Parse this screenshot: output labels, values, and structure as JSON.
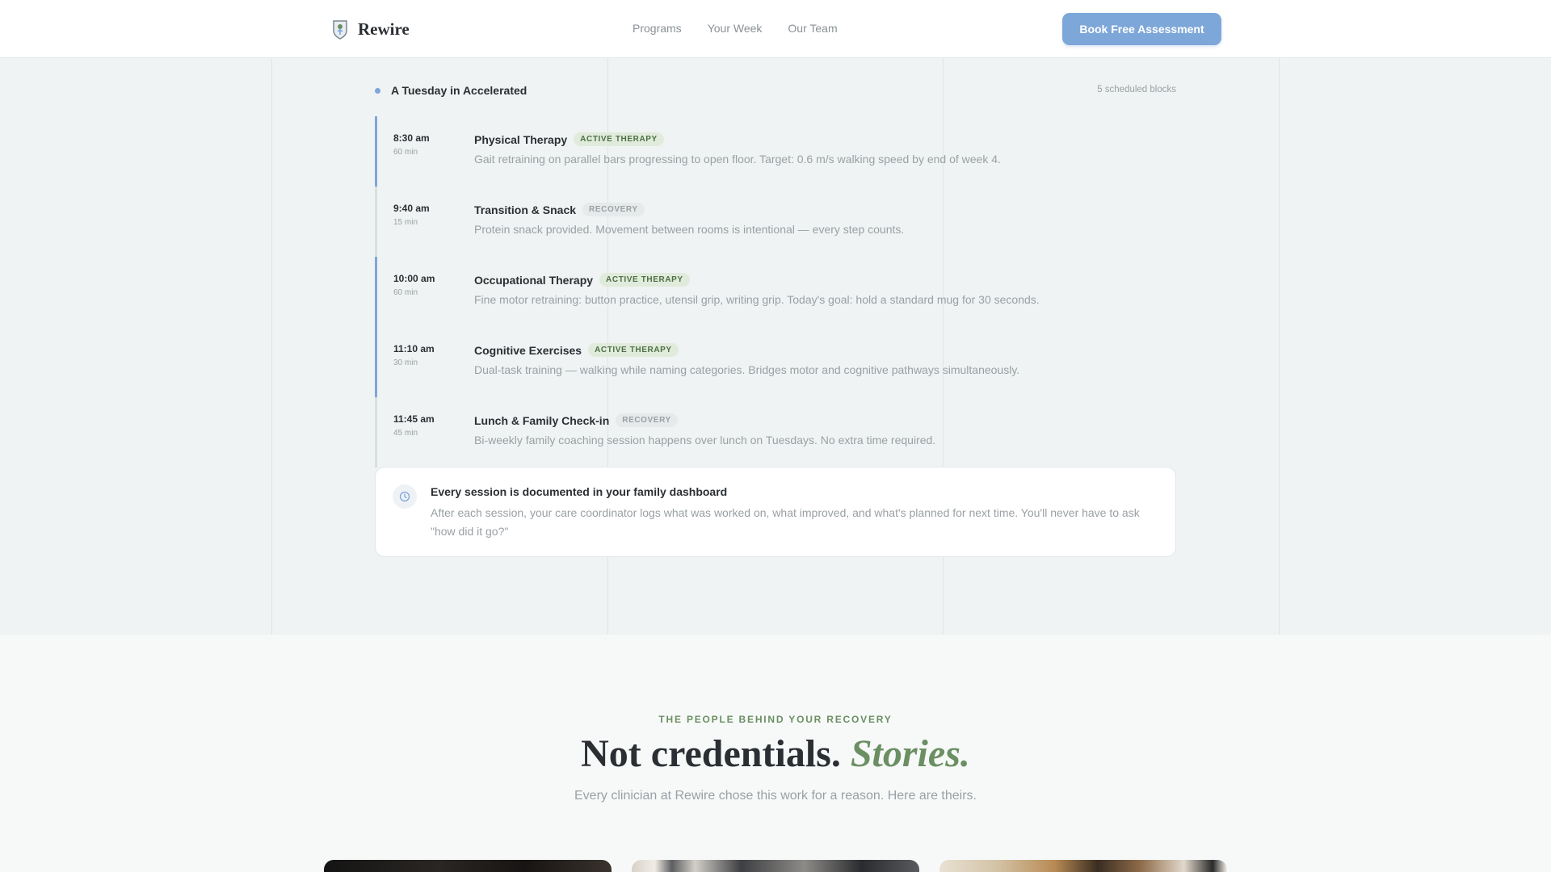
{
  "nav": {
    "brand_name": "Rewire",
    "links": [
      {
        "label": "Programs"
      },
      {
        "label": "Your Week"
      },
      {
        "label": "Our Team"
      }
    ],
    "cta_label": "Book Free Assessment"
  },
  "schedule": {
    "title": "A Tuesday in Accelerated",
    "count_label": "5 scheduled blocks",
    "blocks": [
      {
        "time": "8:30 am",
        "duration": "60 min",
        "title": "Physical Therapy",
        "tag": "ACTIVE THERAPY",
        "description": "Gait retraining on parallel bars progressing to open floor. Target: 0.6 m/s walking speed by end of week 4."
      },
      {
        "time": "9:40 am",
        "duration": "15 min",
        "title": "Transition & Snack",
        "tag": "RECOVERY",
        "description": "Protein snack provided. Movement between rooms is intentional — every step counts."
      },
      {
        "time": "10:00 am",
        "duration": "60 min",
        "title": "Occupational Therapy",
        "tag": "ACTIVE THERAPY",
        "description": "Fine motor retraining: button practice, utensil grip, writing grip. Today's goal: hold a standard mug for 30 seconds."
      },
      {
        "time": "11:10 am",
        "duration": "30 min",
        "title": "Cognitive Exercises",
        "tag": "ACTIVE THERAPY",
        "description": "Dual-task training — walking while naming categories. Bridges motor and cognitive pathways simultaneously."
      },
      {
        "time": "11:45 am",
        "duration": "45 min",
        "title": "Lunch & Family Check-in",
        "tag": "RECOVERY",
        "description": "Bi-weekly family coaching session happens over lunch on Tuesdays. No extra time required."
      }
    ],
    "doc_card": {
      "icon": "clock-icon",
      "title": "Every session is documented in your family dashboard",
      "text": "After each session, your care coordinator logs what was worked on, what improved, and what's planned for next time. You'll never have to ask \"how did it go?\""
    }
  },
  "team": {
    "eyebrow": "THE PEOPLE BEHIND YOUR RECOVERY",
    "title_main": "Not credentials.",
    "title_accent": "Stories.",
    "subtitle": "Every clinician at Rewire chose this work for a reason. Here are theirs."
  },
  "colors": {
    "accent_blue": "#7ea7d9",
    "accent_green": "#6b8f62",
    "text_dark": "#2b2f33",
    "text_muted": "#9aa0a4"
  }
}
